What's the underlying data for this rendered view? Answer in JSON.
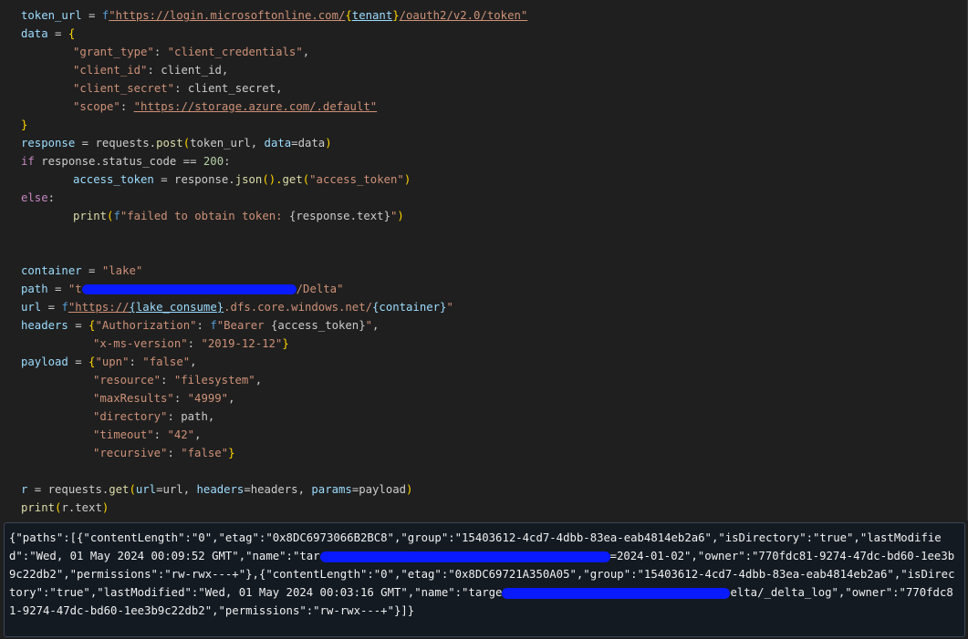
{
  "code": {
    "l1": {
      "a": "token_url",
      "b": " = ",
      "c": "f",
      "d": "\"https://login.microsoftonline.com/",
      "e": "{",
      "f": "tenant",
      "g": "}",
      "h": "/oauth2/v2.0/token\""
    },
    "l2": {
      "a": "data",
      "b": " = ",
      "c": "{"
    },
    "l3": {
      "a": "\"grant_type\"",
      "b": ": ",
      "c": "\"client_credentials\"",
      "d": ","
    },
    "l4": {
      "a": "\"client_id\"",
      "b": ": client_id,"
    },
    "l5": {
      "a": "\"client_secret\"",
      "b": ": client_secret,"
    },
    "l6": {
      "a": "\"scope\"",
      "b": ": ",
      "c": "\"https://storage.azure.com/.default\""
    },
    "l7": {
      "a": "}"
    },
    "l8": {
      "a": "response",
      "b": " = requests.",
      "c": "post",
      "d": "(",
      "e": "token_url, ",
      "f": "data",
      "g": "=data",
      "h": ")"
    },
    "l9": {
      "a": "if",
      "b": " response.status_code == ",
      "c": "200",
      "d": ":"
    },
    "l10": {
      "a": "access_token",
      "b": " = response.",
      "c": "json",
      "d": "().",
      "e": "get",
      "f": "(",
      "g": "\"access_token\"",
      "h": ")"
    },
    "l11": {
      "a": "else",
      "b": ":"
    },
    "l12": {
      "a": "print",
      "b": "(",
      "c": "f",
      "d": "\"failed to obtain token: ",
      "e": "{response.text}",
      "f": "\"",
      "g": ")"
    },
    "l15": {
      "a": "container",
      "b": " = ",
      "c": "\"lake\""
    },
    "l16": {
      "a": "path",
      "b": " = ",
      "c": "\"t",
      "d": "/Delta\""
    },
    "l17": {
      "a": "url",
      "b": " = ",
      "c": "f",
      "d": "\"https://",
      "e": "{lake_consume}",
      "f": ".dfs.core.windows.net/",
      "g": "{container}",
      "h": "\""
    },
    "l18": {
      "a": "headers",
      "b": " = ",
      "c": "{",
      "d": "\"Authorization\"",
      "e": ": ",
      "f": "f",
      "g": "\"Bearer ",
      "h": "{access_token}",
      "i": "\"",
      "j": ","
    },
    "l19": {
      "a": "\"x-ms-version\"",
      "b": ": ",
      "c": "\"2019-12-12\"",
      "d": "}"
    },
    "l20": {
      "a": "payload",
      "b": " = ",
      "c": "{",
      "d": "\"upn\"",
      "e": ": ",
      "f": "\"false\"",
      "g": ","
    },
    "l21": {
      "a": "\"resource\"",
      "b": ": ",
      "c": "\"filesystem\"",
      "d": ","
    },
    "l22": {
      "a": "\"maxResults\"",
      "b": ": ",
      "c": "\"4999\"",
      "d": ","
    },
    "l23": {
      "a": "\"directory\"",
      "b": ": path,"
    },
    "l24": {
      "a": "\"timeout\"",
      "b": ": ",
      "c": "\"42\"",
      "d": ","
    },
    "l25": {
      "a": "\"recursive\"",
      "b": ": ",
      "c": "\"false\"",
      "d": "}"
    },
    "l27": {
      "a": "r",
      "b": " = requests.",
      "c": "get",
      "d": "(",
      "e": "url",
      "f": "=url, ",
      "g": "headers",
      "h": "=headers, ",
      "i": "params",
      "j": "=payload",
      "k": ")"
    },
    "l28": {
      "a": "print",
      "b": "(",
      "c": "r.text",
      "d": ")"
    }
  },
  "output": {
    "p1": "{\"paths\":[{\"contentLength\":\"0\",\"etag\":\"0x8DC6973066B2BC8\",\"group\":\"15403612-4cd7-4dbb-83ea-eab4814eb2a6\",\"isDirectory\":\"true\",\"lastModified\":\"Wed, 01 May 2024 00:09:52 GMT\",\"name\":\"tar",
    "p2": "=2024-01-02\",\"owner\":\"770fdc81-9274-47dc-bd60-1ee3b9c22db2\",\"permissions\":\"rw-rwx---+\"},{\"contentLength\":\"0\",\"etag\":\"0x8DC69721A350A05\",\"group\":\"15403612-4cd7-4dbb-83ea-eab4814eb2a6\",\"isDirectory\":\"true\",\"lastModified\":\"Wed, 01 May 2024 00:03:16 GMT\",\"name\":\"targe",
    "p3": "elta/_delta_log\",\"owner\":\"770fdc81-9274-47dc-bd60-1ee3b9c22db2\",\"permissions\":\"rw-rwx---+\"}]}"
  },
  "colors": {
    "background": "#1f1f1f",
    "variable": "#9cdcfe",
    "string": "#ce9178",
    "function": "#dcdcaa",
    "keyword": "#c586c0",
    "number": "#b5cea8",
    "bracket_gold": "#ffd700",
    "bracket_purple": "#da70d6",
    "bracket_blue": "#179fff",
    "redaction": "#0a1aff"
  }
}
